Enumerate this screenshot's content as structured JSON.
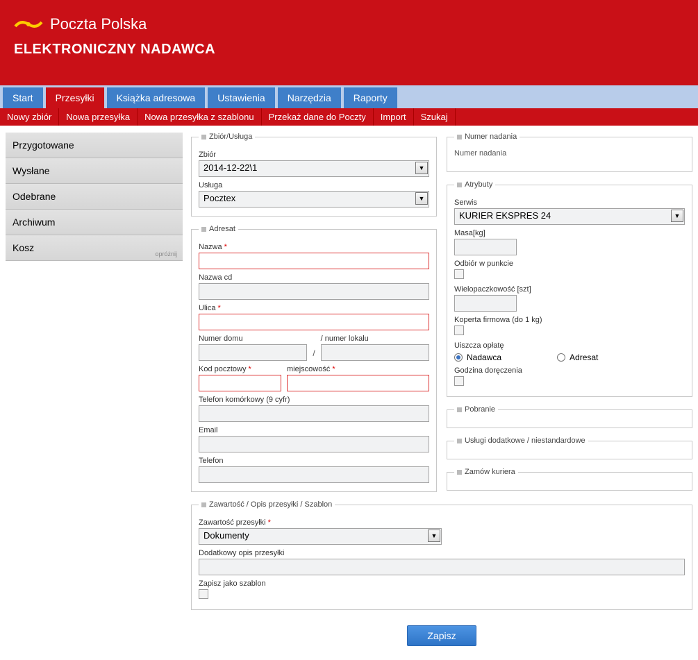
{
  "header": {
    "brand": "Poczta Polska",
    "title": "ELEKTRONICZNY NADAWCA"
  },
  "nav_primary": [
    {
      "label": "Start",
      "active": false
    },
    {
      "label": "Przesyłki",
      "active": true
    },
    {
      "label": "Książka adresowa",
      "active": false
    },
    {
      "label": "Ustawienia",
      "active": false
    },
    {
      "label": "Narzędzia",
      "active": false
    },
    {
      "label": "Raporty",
      "active": false
    }
  ],
  "nav_secondary": [
    "Nowy zbiór",
    "Nowa przesyłka",
    "Nowa przesyłka z szablonu",
    "Przekaż dane do Poczty",
    "Import",
    "Szukaj"
  ],
  "sidebar": {
    "items": [
      "Przygotowane",
      "Wysłane",
      "Odebrane",
      "Archiwum",
      "Kosz"
    ],
    "empty_label": "opróżnij"
  },
  "zbior": {
    "legend": "Zbiór/Usługa",
    "zbior_label": "Zbiór",
    "zbior_value": "2014-12-22\\1",
    "usluga_label": "Usługa",
    "usluga_value": "Pocztex"
  },
  "adresat": {
    "legend": "Adresat",
    "nazwa_label": "Nazwa",
    "nazwa_cd_label": "Nazwa cd",
    "ulica_label": "Ulica",
    "numer_domu_label": "Numer domu",
    "numer_lokalu_label": "/   numer lokalu",
    "kod_label": "Kod pocztowy",
    "miejscowosc_label": "miejscowość",
    "tel_kom_label": "Telefon komórkowy (9 cyfr)",
    "email_label": "Email",
    "telefon_label": "Telefon"
  },
  "zawartosc": {
    "legend": "Zawartość / Opis przesyłki / Szablon",
    "zawartosc_label": "Zawartość przesyłki",
    "zawartosc_value": "Dokumenty",
    "dodatkowy_label": "Dodatkowy opis przesyłki",
    "szablon_label": "Zapisz jako szablon"
  },
  "numer_nadania": {
    "legend": "Numer nadania",
    "text": "Numer nadania"
  },
  "atrybuty": {
    "legend": "Atrybuty",
    "serwis_label": "Serwis",
    "serwis_value": "KURIER EKSPRES 24",
    "masa_label": "Masa[kg]",
    "odbior_label": "Odbiór w punkcie",
    "wielopaczkowosc_label": "Wielopaczkowość [szt]",
    "koperta_label": "Koperta firmowa (do 1 kg)",
    "uiszcza_label": "Uiszcza opłatę",
    "nadawca": "Nadawca",
    "adresat": "Adresat",
    "godzina_label": "Godzina doręczenia"
  },
  "pobranie": {
    "legend": "Pobranie"
  },
  "uslugi_dodatkowe": {
    "legend": "Usługi dodatkowe / niestandardowe"
  },
  "zamow_kuriera": {
    "legend": "Zamów kuriera"
  },
  "save_label": "Zapisz"
}
